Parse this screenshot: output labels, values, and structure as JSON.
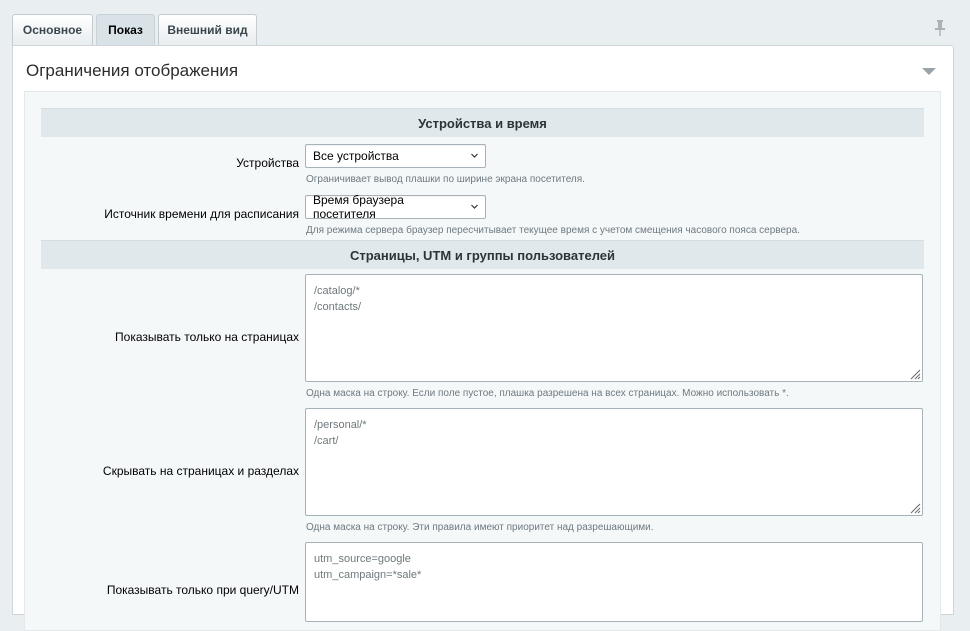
{
  "tabs": [
    {
      "label": "Основное",
      "active": false
    },
    {
      "label": "Показ",
      "active": true
    },
    {
      "label": "Внешний вид",
      "active": false
    }
  ],
  "panel": {
    "title": "Ограничения отображения"
  },
  "sections": {
    "devices_time": {
      "title": "Устройства и время",
      "devices": {
        "label": "Устройства",
        "value": "Все устройства",
        "hint": "Ограничивает вывод плашки по ширине экрана посетителя."
      },
      "time_source": {
        "label": "Источник времени для расписания",
        "value": "Время браузера посетителя",
        "hint": "Для режима сервера браузер пересчитывает текущее время с учетом смещения часового пояса сервера."
      }
    },
    "pages_utm": {
      "title": "Страницы, UTM и группы пользователей",
      "show_pages": {
        "label": "Показывать только на страницах",
        "lines": [
          "/catalog/*",
          "/contacts/"
        ],
        "hint": "Одна маска на строку. Если поле пустое, плашка разрешена на всех страницах. Можно использовать *."
      },
      "hide_pages": {
        "label": "Скрывать на страницах и разделах",
        "lines": [
          "/personal/*",
          "/cart/"
        ],
        "hint": "Одна маска на строку. Эти правила имеют приоритет над разрешающими."
      },
      "query_utm": {
        "label": "Показывать только при query/UTM",
        "lines": [
          "utm_source=google",
          "utm_campaign=*sale*"
        ]
      }
    }
  },
  "colors": {
    "background": "#e9eef0",
    "section_header": "#e0e8ec",
    "hint_text": "#6e7a80"
  },
  "icons": {
    "pin": "pin-icon",
    "collapse": "collapse-arrow-icon",
    "dropdown": "chevron-down-icon",
    "resize": "resize-handle-icon"
  }
}
